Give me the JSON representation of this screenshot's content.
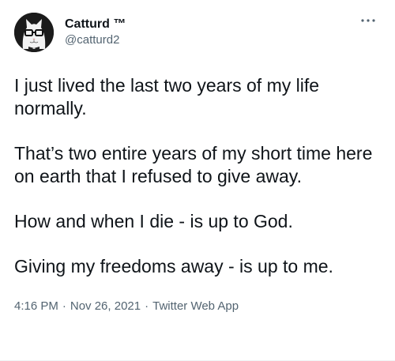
{
  "author": {
    "display_name": "Catturd ™",
    "handle": "@catturd2",
    "avatar_icon": "cat-with-glasses-avatar"
  },
  "more_icon": "more-dots-icon",
  "tweet": {
    "paragraphs": [
      "I just lived the last two years of my life normally.",
      "That’s two entire years of my short time here on earth that I refused to give away.",
      "How and when I die - is up to God.",
      "Giving my freedoms away - is up to me."
    ],
    "time": "4:16 PM",
    "date": "Nov 26, 2021",
    "source": "Twitter Web App",
    "separator": "·"
  },
  "colors": {
    "text_primary": "#0f1419",
    "text_secondary": "#536471"
  }
}
